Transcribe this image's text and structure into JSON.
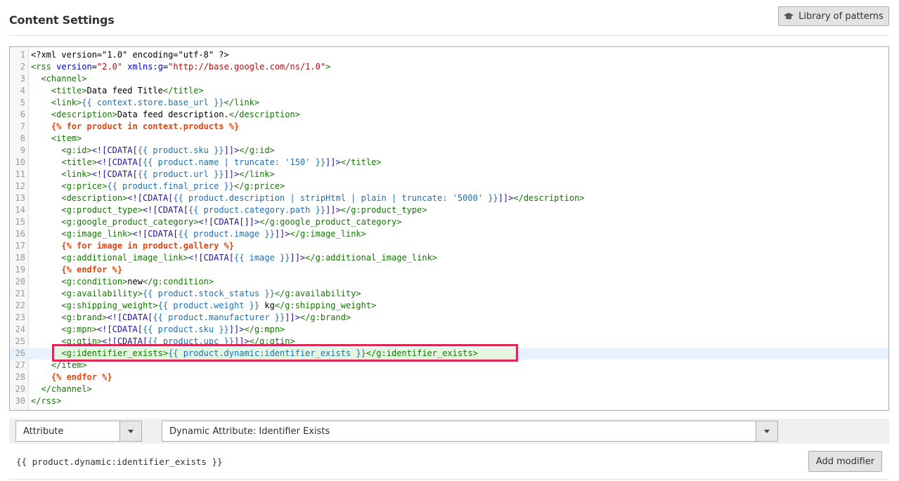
{
  "header": {
    "title": "Content Settings",
    "library_button": "Library of patterns",
    "library_icon": "graduation-cap-icon"
  },
  "editor": {
    "active_line": 26,
    "highlight_color": "#e22654",
    "lines": [
      [
        [
          "t-text",
          "<?xml version=\"1.0\" encoding=\"utf-8\" ?>"
        ]
      ],
      [
        [
          "t-tag",
          "<rss "
        ],
        [
          "t-attr",
          "version"
        ],
        [
          "t-text",
          "="
        ],
        [
          "t-str",
          "\"2.0\""
        ],
        [
          "t-text",
          " "
        ],
        [
          "t-attr",
          "xmlns:g"
        ],
        [
          "t-text",
          "="
        ],
        [
          "t-str",
          "\"http://base.google.com/ns/1.0\""
        ],
        [
          "t-tag",
          ">"
        ]
      ],
      [
        [
          "t-tag",
          "  <channel>"
        ]
      ],
      [
        [
          "t-tag",
          "    <title>"
        ],
        [
          "t-text",
          "Data feed Title"
        ],
        [
          "t-tag",
          "</title>"
        ]
      ],
      [
        [
          "t-tag",
          "    <link>"
        ],
        [
          "t-tpl",
          "{{ context.store.base_url }}"
        ],
        [
          "t-tag",
          "</link>"
        ]
      ],
      [
        [
          "t-tag",
          "    <description>"
        ],
        [
          "t-text",
          "Data feed description."
        ],
        [
          "t-tag",
          "</description>"
        ]
      ],
      [
        [
          "t-ctrl",
          "    {% for product in context.products %}"
        ]
      ],
      [
        [
          "t-tag",
          "    <item>"
        ]
      ],
      [
        [
          "t-tag",
          "      <g:id>"
        ],
        [
          "t-cdata",
          "<![CDATA["
        ],
        [
          "t-tpl",
          "{{ product.sku }}"
        ],
        [
          "t-cdata",
          "]]>"
        ],
        [
          "t-tag",
          "</g:id>"
        ]
      ],
      [
        [
          "t-tag",
          "      <title>"
        ],
        [
          "t-cdata",
          "<![CDATA["
        ],
        [
          "t-tpl",
          "{{ product.name | truncate: '150' }}"
        ],
        [
          "t-cdata",
          "]]>"
        ],
        [
          "t-tag",
          "</title>"
        ]
      ],
      [
        [
          "t-tag",
          "      <link>"
        ],
        [
          "t-cdata",
          "<![CDATA["
        ],
        [
          "t-tpl",
          "{{ product.url }}"
        ],
        [
          "t-cdata",
          "]]>"
        ],
        [
          "t-tag",
          "</link>"
        ]
      ],
      [
        [
          "t-tag",
          "      <g:price>"
        ],
        [
          "t-tpl",
          "{{ product.final_price }}"
        ],
        [
          "t-tag",
          "</g:price>"
        ]
      ],
      [
        [
          "t-tag",
          "      <description>"
        ],
        [
          "t-cdata",
          "<![CDATA["
        ],
        [
          "t-tpl",
          "{{ product.description | stripHtml | plain | truncate: '5000' }}"
        ],
        [
          "t-cdata",
          "]]>"
        ],
        [
          "t-tag",
          "</description>"
        ]
      ],
      [
        [
          "t-tag",
          "      <g:product_type>"
        ],
        [
          "t-cdata",
          "<![CDATA["
        ],
        [
          "t-tpl",
          "{{ product.category.path }}"
        ],
        [
          "t-cdata",
          "]]>"
        ],
        [
          "t-tag",
          "</g:product_type>"
        ]
      ],
      [
        [
          "t-tag",
          "      <g:google_product_category>"
        ],
        [
          "t-cdata",
          "<![CDATA[]]>"
        ],
        [
          "t-tag",
          "</g:google_product_category>"
        ]
      ],
      [
        [
          "t-tag",
          "      <g:image_link>"
        ],
        [
          "t-cdata",
          "<![CDATA["
        ],
        [
          "t-tpl",
          "{{ product.image }}"
        ],
        [
          "t-cdata",
          "]]>"
        ],
        [
          "t-tag",
          "</g:image_link>"
        ]
      ],
      [
        [
          "t-ctrl",
          "      {% for image in product.gallery %}"
        ]
      ],
      [
        [
          "t-tag",
          "      <g:additional_image_link>"
        ],
        [
          "t-cdata",
          "<![CDATA["
        ],
        [
          "t-tpl",
          "{{ image }}"
        ],
        [
          "t-cdata",
          "]]>"
        ],
        [
          "t-tag",
          "</g:additional_image_link>"
        ]
      ],
      [
        [
          "t-ctrl",
          "      {% endfor %}"
        ]
      ],
      [
        [
          "t-tag",
          "      <g:condition>"
        ],
        [
          "t-text",
          "new"
        ],
        [
          "t-tag",
          "</g:condition>"
        ]
      ],
      [
        [
          "t-tag",
          "      <g:availability>"
        ],
        [
          "t-tpl",
          "{{ product.stock_status }}"
        ],
        [
          "t-tag",
          "</g:availability>"
        ]
      ],
      [
        [
          "t-tag",
          "      <g:shipping_weight>"
        ],
        [
          "t-tpl",
          "{{ product.weight }}"
        ],
        [
          "t-text",
          " kg"
        ],
        [
          "t-tag",
          "</g:shipping_weight>"
        ]
      ],
      [
        [
          "t-tag",
          "      <g:brand>"
        ],
        [
          "t-cdata",
          "<![CDATA["
        ],
        [
          "t-tpl",
          "{{ product.manufacturer }}"
        ],
        [
          "t-cdata",
          "]]>"
        ],
        [
          "t-tag",
          "</g:brand>"
        ]
      ],
      [
        [
          "t-tag",
          "      <g:mpn>"
        ],
        [
          "t-cdata",
          "<![CDATA["
        ],
        [
          "t-tpl",
          "{{ product.sku }}"
        ],
        [
          "t-cdata",
          "]]>"
        ],
        [
          "t-tag",
          "</g:mpn>"
        ]
      ],
      [
        [
          "t-tag",
          "      <g:gtin>"
        ],
        [
          "t-cdata",
          "<![CDATA["
        ],
        [
          "t-tpl",
          "{{ product.upc }}"
        ],
        [
          "t-cdata",
          "]]>"
        ],
        [
          "t-tag",
          "</g:gtin>"
        ]
      ],
      [
        [
          "t-tag",
          "      <g:identifier_exists>"
        ],
        [
          "t-tpl",
          "{{ product.dynamic:identifier_exists }}"
        ],
        [
          "t-tag",
          "</g:identifier_exists>"
        ]
      ],
      [
        [
          "t-tag",
          "    </item>"
        ]
      ],
      [
        [
          "t-ctrl",
          "    {% endfor %}"
        ]
      ],
      [
        [
          "t-tag",
          "  </channel>"
        ]
      ],
      [
        [
          "t-tag",
          "</rss>"
        ]
      ]
    ]
  },
  "toolbar": {
    "type_select": "Attribute",
    "attribute_select": "Dynamic Attribute: Identifier Exists"
  },
  "preview": {
    "text": "{{ product.dynamic:identifier_exists }}",
    "add_modifier_button": "Add modifier"
  }
}
